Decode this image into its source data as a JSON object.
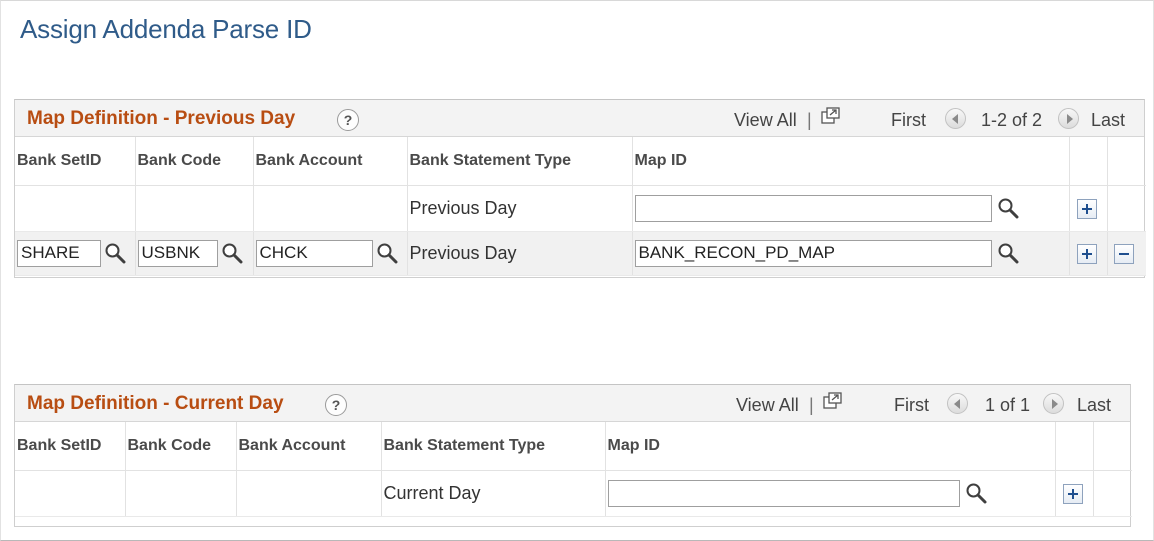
{
  "page": {
    "title": "Assign Addenda Parse ID"
  },
  "columns": [
    "Bank SetID",
    "Bank Code",
    "Bank Account",
    "Bank Statement Type",
    "Map ID"
  ],
  "nav": {
    "view_all": "View All",
    "separator": "|",
    "first": "First",
    "last": "Last"
  },
  "help_glyph": "?",
  "icons": {
    "help": "help-icon",
    "view_all": "new-window-icon",
    "prev": "prev-arrow-icon",
    "next": "next-arrow-icon",
    "lookup": "search-icon",
    "add": "add-row-icon",
    "delete": "delete-row-icon"
  },
  "colors": {
    "title": "#2f5b89",
    "grid_title": "#b84d12",
    "alt_row": "#f1f1f1"
  },
  "previous_day": {
    "title": "Map Definition - Previous Day",
    "range": "1-2 of 2",
    "rows": [
      {
        "setid": "",
        "bank_code": "",
        "bank_account": "",
        "statement_type": "Previous Day",
        "map_id": ""
      },
      {
        "setid": "SHARE",
        "bank_code": "USBNK",
        "bank_account": "CHCK",
        "statement_type": "Previous Day",
        "map_id": "BANK_RECON_PD_MAP"
      }
    ]
  },
  "current_day": {
    "title": "Map Definition - Current Day",
    "range": "1 of 1",
    "rows": [
      {
        "setid": "",
        "bank_code": "",
        "bank_account": "",
        "statement_type": "Current Day",
        "map_id": ""
      }
    ]
  }
}
